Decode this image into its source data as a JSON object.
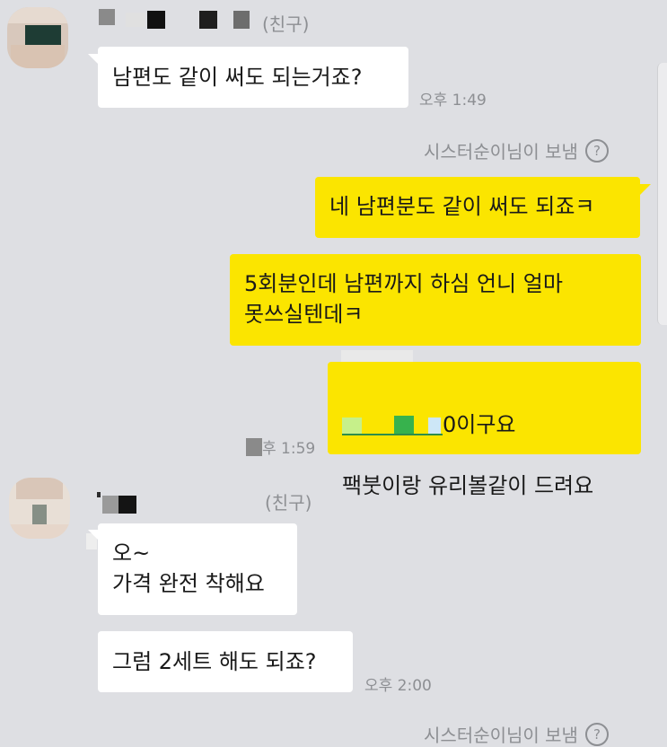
{
  "chat": {
    "friend_tag": "(친구)",
    "sender_note": "시스터순이님이 보냄",
    "help_icon": "?",
    "messages": [
      {
        "id": "m1",
        "side": "received",
        "text": "남편도 같이 써도 되는거죠?",
        "time": "오후 1:49"
      },
      {
        "id": "m2",
        "side": "sent",
        "text": "네 남편분도 같이 써도 되죠ㅋ"
      },
      {
        "id": "m3",
        "side": "sent",
        "text": "5회분인데 남편까지 하심 언니 얼마\n못쓰실텐데ㅋ"
      },
      {
        "id": "m4",
        "side": "sent",
        "line1_suffix": "0이구요",
        "line2": "팩붓이랑 유리볼같이 드려요",
        "time": "후 1:59"
      },
      {
        "id": "m5",
        "side": "received",
        "text": "오~\n가격 완전 착해요"
      },
      {
        "id": "m6",
        "side": "received",
        "text": "그럼 2세트 해도 되죠?",
        "time": "오후 2:00"
      }
    ]
  },
  "colors": {
    "background": "#dedfe3",
    "received_bubble": "#ffffff",
    "sent_bubble": "#fbe500",
    "meta_text": "#8d8f93"
  },
  "icons": {
    "help": "question-circle-icon",
    "avatar": "profile-avatar"
  }
}
